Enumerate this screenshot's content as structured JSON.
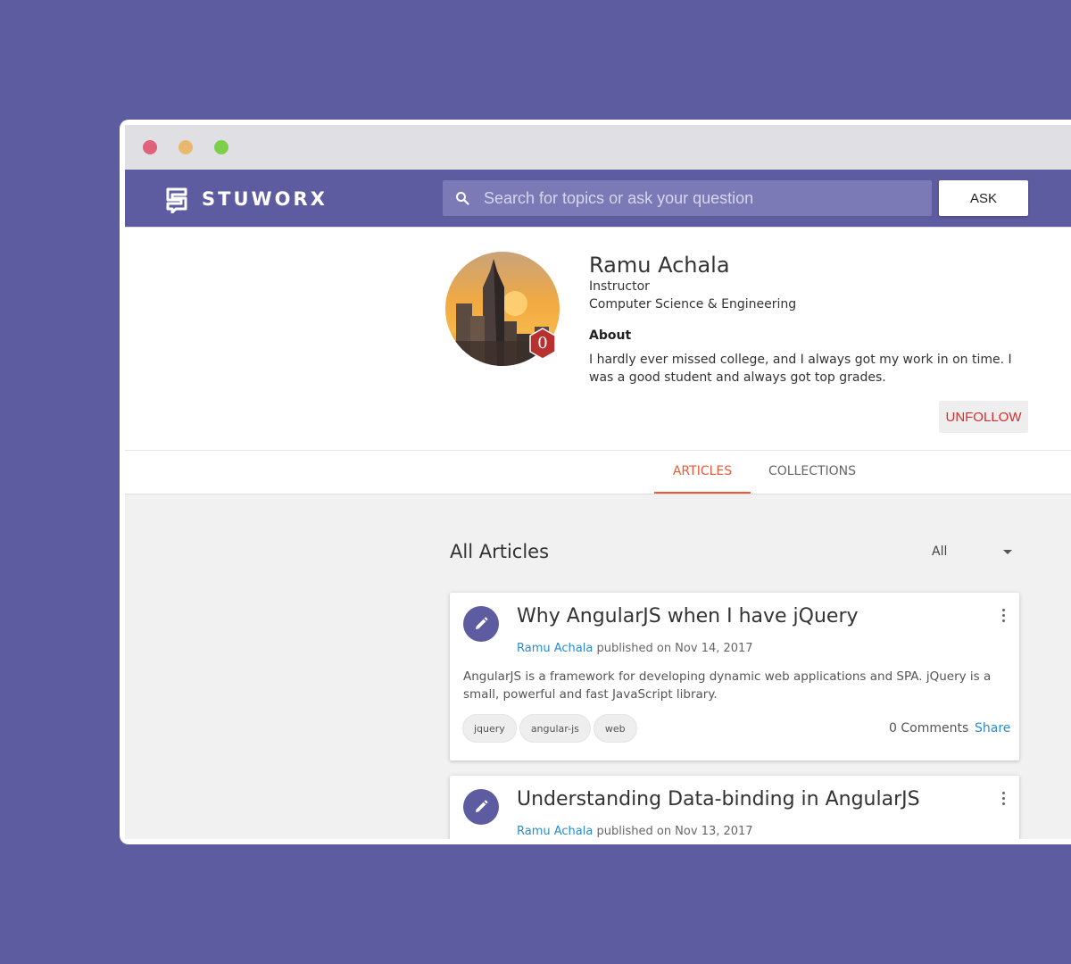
{
  "app": {
    "name": "STUWORX"
  },
  "header": {
    "search_placeholder": "Search for topics or ask your question",
    "ask_label": "ASK"
  },
  "profile": {
    "name": "Ramu Achala",
    "role": "Instructor",
    "department": "Computer Science & Engineering",
    "about_heading": "About",
    "about_text": "I hardly ever missed college, and I always got my work in on time. I was a good student and always got top grades.",
    "badge_count": "0",
    "unfollow_label": "UNFOLLOW"
  },
  "tabs": [
    {
      "label": "ARTICLES",
      "active": true
    },
    {
      "label": "COLLECTIONS",
      "active": false
    }
  ],
  "articles_section": {
    "title": "All Articles",
    "filter_value": "All"
  },
  "articles": [
    {
      "title": "Why AngularJS when I have jQuery",
      "author": "Ramu Achala",
      "published_text": "published on Nov 14, 2017",
      "excerpt": "AngularJS is a framework for developing dynamic web applications and SPA. jQuery is a small, powerful and fast JavaScript library.",
      "tags": [
        "jquery",
        "angular-js",
        "web"
      ],
      "comments_label": "0 Comments",
      "share_label": "Share"
    },
    {
      "title": "Understanding Data-binding in AngularJS",
      "author": "Ramu Achala",
      "published_text": "published on Nov 13, 2017"
    }
  ],
  "colors": {
    "brand": "#5e5ca0",
    "accent": "#e85a3a",
    "link": "#2a8bd0",
    "danger": "#d32f2f"
  },
  "icons": {
    "search": "search-icon",
    "edit": "pencil-icon",
    "menu": "more-vert-icon",
    "dropdown": "chevron-down-icon"
  }
}
